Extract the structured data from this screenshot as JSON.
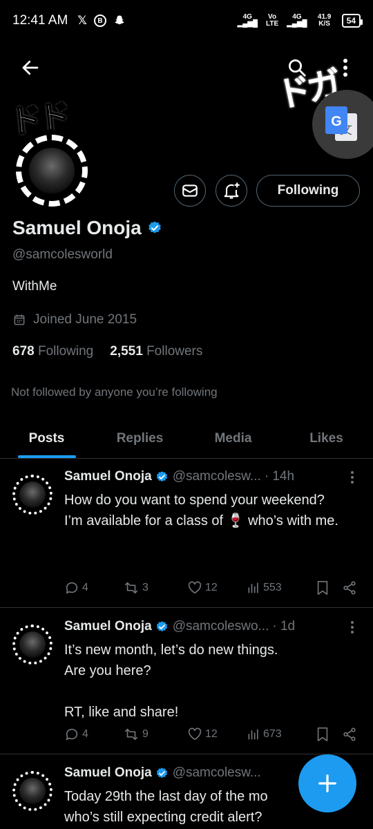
{
  "status_bar": {
    "time": "12:41 AM",
    "left_icons": [
      "x-icon",
      "b-icon",
      "snapchat-icon"
    ],
    "net1": "4G",
    "volte": "Vo LTE",
    "net2": "4G",
    "speed": "41.9 K/S",
    "battery": "54"
  },
  "header": {
    "banner_left_text": "ドド",
    "banner_right_text": "ドガ"
  },
  "profile": {
    "name": "Samuel Onoja",
    "handle": "@samcolesworld",
    "bio": "WithMe",
    "joined": "Joined June 2015",
    "following_count": "678",
    "following_label": "Following",
    "followers_count": "2,551",
    "followers_label": "Followers",
    "not_followed": "Not followed by anyone you’re following",
    "following_button": "Following"
  },
  "tabs": [
    {
      "label": "Posts",
      "active": true
    },
    {
      "label": "Replies",
      "active": false
    },
    {
      "label": "Media",
      "active": false
    },
    {
      "label": "Likes",
      "active": false
    }
  ],
  "posts": [
    {
      "name": "Samuel Onoja",
      "handle": "@samcolesw...",
      "time": "· 14h",
      "text": "How do you want to spend your weekend?\nI’m available for a class of 🍷 who’s with me.",
      "replies": "4",
      "reposts": "3",
      "likes": "12",
      "views": "553"
    },
    {
      "name": "Samuel Onoja",
      "handle": "@samcoleswo...",
      "time": "· 1d",
      "text": "It’s new month, let’s do new things.\nAre you here?\n\nRT, like and share!",
      "replies": "4",
      "reposts": "9",
      "likes": "12",
      "views": "673"
    },
    {
      "name": "Samuel Onoja",
      "handle": "@samcolesw...",
      "time": "",
      "text": "Today 29th the last day of the mo\nwho’s still expecting credit alert?",
      "replies": "",
      "reposts": "",
      "likes": "",
      "views": ""
    }
  ],
  "colors": {
    "accent": "#1d9bf0",
    "background": "#000000",
    "text_primary": "#e7e9ea",
    "text_secondary": "#71767b"
  }
}
